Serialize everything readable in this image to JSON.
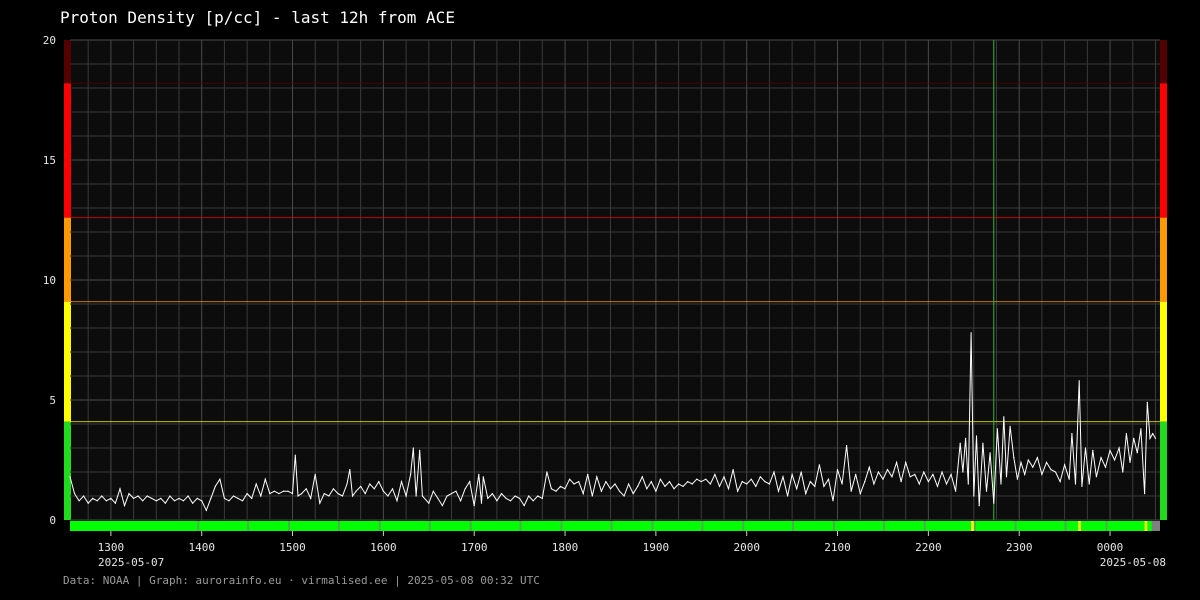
{
  "page": {
    "title": "Proton Density [p/cc] - last 12h from ACE",
    "footer": "Data: NOAA | Graph: aurorainfo.eu · virmalised.ee | 2025-05-08 00:32 UTC"
  },
  "colors": {
    "background": "#000000",
    "grid": "#3a3a3a",
    "line": "#ffffff",
    "level_green": "#1fdc1f",
    "level_yellow": "#ffff00",
    "level_orange": "#ff9900",
    "level_red": "#ff0000",
    "level_darkred": "#550000",
    "status_ok": "#00ff00",
    "status_warn": "#ffff00",
    "status_nodata": "#808080",
    "marker_line": "#2fbf2f"
  },
  "chart_data": {
    "type": "line",
    "title": "Proton Density [p/cc] - last 12h from ACE",
    "ylim": [
      0,
      20
    ],
    "y_ticks": [
      "0",
      "5",
      "10",
      "15",
      "20"
    ],
    "x_ticks": [
      "1300",
      "1400",
      "1500",
      "1600",
      "1700",
      "1800",
      "1900",
      "2000",
      "2100",
      "2200",
      "2300",
      "0000"
    ],
    "x_tick_hours": [
      13,
      14,
      15,
      16,
      17,
      18,
      19,
      20,
      21,
      22,
      23,
      24
    ],
    "x_range_hours": [
      12.55,
      24.55
    ],
    "date_labels": {
      "start": "2025-05-07",
      "end": "2025-05-08"
    },
    "grid": true,
    "threshold_bands": [
      {
        "from": 0,
        "to": 4.1,
        "level": "green"
      },
      {
        "from": 4.1,
        "to": 9.1,
        "level": "yellow"
      },
      {
        "from": 9.1,
        "to": 12.6,
        "level": "orange"
      },
      {
        "from": 12.6,
        "to": 18.2,
        "level": "red"
      },
      {
        "from": 18.2,
        "to": 20,
        "level": "darkred"
      }
    ],
    "threshold_lines": [
      4.1,
      9.1,
      12.6,
      18.2
    ],
    "marker_time_hours": 22.72,
    "status_bar": [
      {
        "from_hours": 22.47,
        "to_hours": 22.5,
        "status": "warn"
      },
      {
        "from_hours": 23.65,
        "to_hours": 23.68,
        "status": "warn"
      },
      {
        "from_hours": 24.38,
        "to_hours": 24.41,
        "status": "warn"
      },
      {
        "from_hours": 24.46,
        "to_hours": 24.55,
        "status": "nodata"
      }
    ],
    "series": [
      {
        "values": [
          [
            12.55,
            1.8
          ],
          [
            12.6,
            1.1
          ],
          [
            12.65,
            0.8
          ],
          [
            12.7,
            1.0
          ],
          [
            12.75,
            0.7
          ],
          [
            12.8,
            0.9
          ],
          [
            12.85,
            0.8
          ],
          [
            12.9,
            1.0
          ],
          [
            12.95,
            0.8
          ],
          [
            13.0,
            0.9
          ],
          [
            13.05,
            0.7
          ],
          [
            13.1,
            1.3
          ],
          [
            13.15,
            0.6
          ],
          [
            13.2,
            1.1
          ],
          [
            13.25,
            0.9
          ],
          [
            13.3,
            1.0
          ],
          [
            13.35,
            0.8
          ],
          [
            13.4,
            1.0
          ],
          [
            13.45,
            0.9
          ],
          [
            13.5,
            0.8
          ],
          [
            13.55,
            0.9
          ],
          [
            13.6,
            0.7
          ],
          [
            13.65,
            1.0
          ],
          [
            13.7,
            0.8
          ],
          [
            13.75,
            0.9
          ],
          [
            13.8,
            0.8
          ],
          [
            13.85,
            1.0
          ],
          [
            13.9,
            0.7
          ],
          [
            13.95,
            0.9
          ],
          [
            14.0,
            0.8
          ],
          [
            14.05,
            0.4
          ],
          [
            14.1,
            0.9
          ],
          [
            14.15,
            1.4
          ],
          [
            14.2,
            1.7
          ],
          [
            14.25,
            0.9
          ],
          [
            14.3,
            0.8
          ],
          [
            14.35,
            1.0
          ],
          [
            14.4,
            0.9
          ],
          [
            14.45,
            0.8
          ],
          [
            14.5,
            1.1
          ],
          [
            14.55,
            0.9
          ],
          [
            14.6,
            1.5
          ],
          [
            14.65,
            1.0
          ],
          [
            14.7,
            1.7
          ],
          [
            14.75,
            1.1
          ],
          [
            14.8,
            1.2
          ],
          [
            14.85,
            1.1
          ],
          [
            14.9,
            1.2
          ],
          [
            14.95,
            1.2
          ],
          [
            15.0,
            1.1
          ],
          [
            15.03,
            2.7
          ],
          [
            15.06,
            1.0
          ],
          [
            15.1,
            1.1
          ],
          [
            15.15,
            1.3
          ],
          [
            15.2,
            0.9
          ],
          [
            15.25,
            1.9
          ],
          [
            15.3,
            0.7
          ],
          [
            15.35,
            1.1
          ],
          [
            15.4,
            1.0
          ],
          [
            15.45,
            1.3
          ],
          [
            15.5,
            1.1
          ],
          [
            15.55,
            1.0
          ],
          [
            15.6,
            1.5
          ],
          [
            15.63,
            2.1
          ],
          [
            15.66,
            1.0
          ],
          [
            15.7,
            1.2
          ],
          [
            15.75,
            1.4
          ],
          [
            15.8,
            1.1
          ],
          [
            15.85,
            1.5
          ],
          [
            15.9,
            1.3
          ],
          [
            15.95,
            1.6
          ],
          [
            16.0,
            1.2
          ],
          [
            16.05,
            1.0
          ],
          [
            16.1,
            1.3
          ],
          [
            16.15,
            0.8
          ],
          [
            16.2,
            1.6
          ],
          [
            16.25,
            1.0
          ],
          [
            16.3,
            1.9
          ],
          [
            16.33,
            3.0
          ],
          [
            16.36,
            1.0
          ],
          [
            16.4,
            2.9
          ],
          [
            16.43,
            1.0
          ],
          [
            16.5,
            0.7
          ],
          [
            16.55,
            1.2
          ],
          [
            16.6,
            0.9
          ],
          [
            16.65,
            0.6
          ],
          [
            16.7,
            1.0
          ],
          [
            16.75,
            1.1
          ],
          [
            16.8,
            1.2
          ],
          [
            16.85,
            0.8
          ],
          [
            16.9,
            1.3
          ],
          [
            16.95,
            1.6
          ],
          [
            17.0,
            0.6
          ],
          [
            17.05,
            1.9
          ],
          [
            17.08,
            0.7
          ],
          [
            17.1,
            1.8
          ],
          [
            17.15,
            0.9
          ],
          [
            17.2,
            1.1
          ],
          [
            17.25,
            0.8
          ],
          [
            17.3,
            1.1
          ],
          [
            17.35,
            0.9
          ],
          [
            17.4,
            0.8
          ],
          [
            17.45,
            1.0
          ],
          [
            17.5,
            0.9
          ],
          [
            17.55,
            0.6
          ],
          [
            17.6,
            1.0
          ],
          [
            17.65,
            0.8
          ],
          [
            17.7,
            1.0
          ],
          [
            17.75,
            0.9
          ],
          [
            17.8,
            2.0
          ],
          [
            17.85,
            1.3
          ],
          [
            17.9,
            1.2
          ],
          [
            17.95,
            1.4
          ],
          [
            18.0,
            1.3
          ],
          [
            18.05,
            1.7
          ],
          [
            18.1,
            1.5
          ],
          [
            18.15,
            1.6
          ],
          [
            18.2,
            1.1
          ],
          [
            18.25,
            1.9
          ],
          [
            18.3,
            1.0
          ],
          [
            18.35,
            1.8
          ],
          [
            18.4,
            1.2
          ],
          [
            18.45,
            1.6
          ],
          [
            18.5,
            1.3
          ],
          [
            18.55,
            1.5
          ],
          [
            18.6,
            1.2
          ],
          [
            18.65,
            1.0
          ],
          [
            18.7,
            1.5
          ],
          [
            18.75,
            1.1
          ],
          [
            18.8,
            1.4
          ],
          [
            18.85,
            1.8
          ],
          [
            18.9,
            1.3
          ],
          [
            18.95,
            1.6
          ],
          [
            19.0,
            1.2
          ],
          [
            19.05,
            1.7
          ],
          [
            19.1,
            1.4
          ],
          [
            19.15,
            1.6
          ],
          [
            19.2,
            1.3
          ],
          [
            19.25,
            1.5
          ],
          [
            19.3,
            1.4
          ],
          [
            19.35,
            1.6
          ],
          [
            19.4,
            1.5
          ],
          [
            19.45,
            1.7
          ],
          [
            19.5,
            1.6
          ],
          [
            19.55,
            1.7
          ],
          [
            19.6,
            1.5
          ],
          [
            19.65,
            1.9
          ],
          [
            19.7,
            1.4
          ],
          [
            19.75,
            1.8
          ],
          [
            19.8,
            1.3
          ],
          [
            19.85,
            2.1
          ],
          [
            19.9,
            1.2
          ],
          [
            19.95,
            1.6
          ],
          [
            20.0,
            1.5
          ],
          [
            20.05,
            1.7
          ],
          [
            20.1,
            1.4
          ],
          [
            20.15,
            1.8
          ],
          [
            20.2,
            1.6
          ],
          [
            20.25,
            1.5
          ],
          [
            20.3,
            2.0
          ],
          [
            20.35,
            1.2
          ],
          [
            20.4,
            1.8
          ],
          [
            20.45,
            1.0
          ],
          [
            20.5,
            1.9
          ],
          [
            20.55,
            1.3
          ],
          [
            20.6,
            2.0
          ],
          [
            20.65,
            1.1
          ],
          [
            20.7,
            1.6
          ],
          [
            20.75,
            1.4
          ],
          [
            20.8,
            2.3
          ],
          [
            20.85,
            1.4
          ],
          [
            20.9,
            1.7
          ],
          [
            20.95,
            0.8
          ],
          [
            21.0,
            2.1
          ],
          [
            21.05,
            1.5
          ],
          [
            21.1,
            3.1
          ],
          [
            21.15,
            1.2
          ],
          [
            21.2,
            1.9
          ],
          [
            21.25,
            1.1
          ],
          [
            21.3,
            1.6
          ],
          [
            21.35,
            2.2
          ],
          [
            21.4,
            1.5
          ],
          [
            21.45,
            2.0
          ],
          [
            21.5,
            1.7
          ],
          [
            21.55,
            2.1
          ],
          [
            21.6,
            1.8
          ],
          [
            21.65,
            2.4
          ],
          [
            21.7,
            1.6
          ],
          [
            21.75,
            2.4
          ],
          [
            21.8,
            1.8
          ],
          [
            21.85,
            1.9
          ],
          [
            21.9,
            1.5
          ],
          [
            21.95,
            2.0
          ],
          [
            22.0,
            1.6
          ],
          [
            22.05,
            1.9
          ],
          [
            22.1,
            1.4
          ],
          [
            22.15,
            2.0
          ],
          [
            22.2,
            1.5
          ],
          [
            22.25,
            1.9
          ],
          [
            22.3,
            1.2
          ],
          [
            22.35,
            3.2
          ],
          [
            22.38,
            2.0
          ],
          [
            22.41,
            3.4
          ],
          [
            22.44,
            1.5
          ],
          [
            22.47,
            7.8
          ],
          [
            22.5,
            1.0
          ],
          [
            22.53,
            3.5
          ],
          [
            22.56,
            0.6
          ],
          [
            22.6,
            3.2
          ],
          [
            22.64,
            1.2
          ],
          [
            22.68,
            2.8
          ],
          [
            22.72,
            0.7
          ],
          [
            22.76,
            3.8
          ],
          [
            22.8,
            1.5
          ],
          [
            22.83,
            4.3
          ],
          [
            22.86,
            1.8
          ],
          [
            22.9,
            3.9
          ],
          [
            22.94,
            2.6
          ],
          [
            22.98,
            1.7
          ],
          [
            23.02,
            2.4
          ],
          [
            23.06,
            1.9
          ],
          [
            23.1,
            2.5
          ],
          [
            23.15,
            2.2
          ],
          [
            23.2,
            2.6
          ],
          [
            23.25,
            1.9
          ],
          [
            23.3,
            2.4
          ],
          [
            23.35,
            2.1
          ],
          [
            23.4,
            2.0
          ],
          [
            23.45,
            1.6
          ],
          [
            23.5,
            2.3
          ],
          [
            23.55,
            1.7
          ],
          [
            23.58,
            3.6
          ],
          [
            23.62,
            1.5
          ],
          [
            23.66,
            5.8
          ],
          [
            23.69,
            1.4
          ],
          [
            23.73,
            3.0
          ],
          [
            23.77,
            1.5
          ],
          [
            23.81,
            2.9
          ],
          [
            23.85,
            1.8
          ],
          [
            23.9,
            2.6
          ],
          [
            23.95,
            2.2
          ],
          [
            24.0,
            2.9
          ],
          [
            24.05,
            2.5
          ],
          [
            24.1,
            3.0
          ],
          [
            24.14,
            2.0
          ],
          [
            24.18,
            3.6
          ],
          [
            24.22,
            2.4
          ],
          [
            24.26,
            3.4
          ],
          [
            24.3,
            2.8
          ],
          [
            24.34,
            3.8
          ],
          [
            24.38,
            1.1
          ],
          [
            24.41,
            4.9
          ],
          [
            24.44,
            3.4
          ],
          [
            24.47,
            3.6
          ],
          [
            24.5,
            3.4
          ]
        ]
      }
    ]
  }
}
